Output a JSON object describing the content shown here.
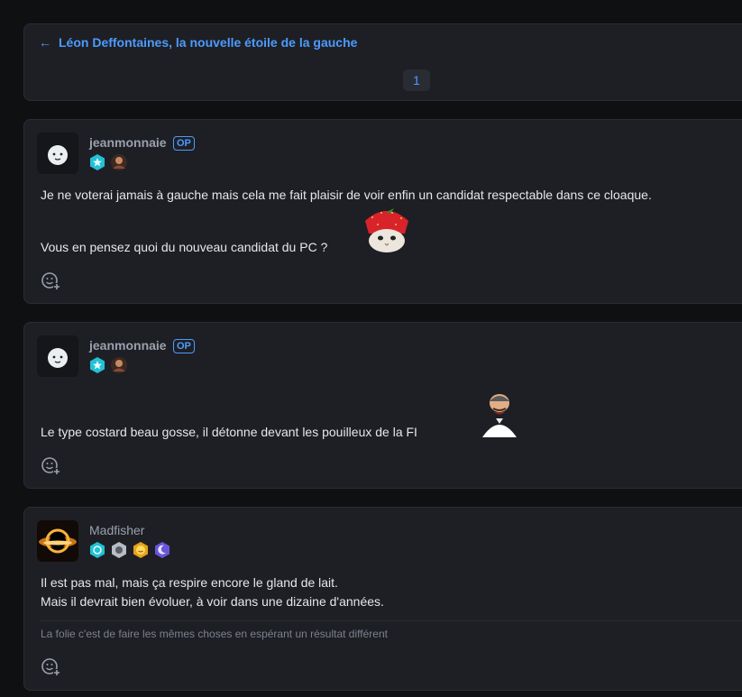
{
  "topic": {
    "back_title": "Léon Deffontaines, la nouvelle étoile de la gauche",
    "page": "1"
  },
  "posts": [
    {
      "username": "jeanmonnaie",
      "op": "OP",
      "lines": [
        "Je ne voterai jamais à gauche mais cela me fait plaisir de voir enfin un candidat respectable dans ce cloaque.",
        "Vous en pensez quoi du nouveau candidat du PC ?"
      ]
    },
    {
      "username": "jeanmonnaie",
      "op": "OP",
      "lines": [
        "Le type costard beau gosse, il détonne devant les pouilleux de la FI"
      ]
    },
    {
      "username": "Madfisher",
      "lines": [
        "Il est pas mal, mais ça respire encore le gland de lait.",
        "Mais il devrait bien évoluer, à voir dans une dizaine d'années."
      ],
      "signature": "La folie c'est de faire les mêmes choses en espérant un résultat différent"
    }
  ],
  "colors": {
    "background": "#0f1012",
    "card": "#1e1f24",
    "accent": "#4c9bff",
    "username": "#9aa0ad"
  }
}
